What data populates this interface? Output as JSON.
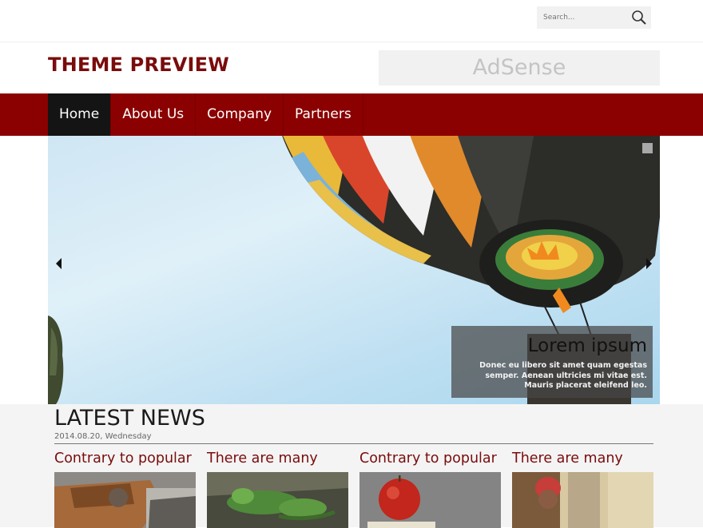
{
  "search": {
    "placeholder": "Search..."
  },
  "header": {
    "logo": "THEME PREVIEW",
    "ad_label": "AdSense"
  },
  "nav": {
    "items": [
      "Home",
      "About Us",
      "Company",
      "Partners"
    ]
  },
  "slider": {
    "caption_title": "Lorem ipsum",
    "caption_text": "Donec eu libero sit amet quam egestas semper. Aenean ultricies mi vitae est. Mauris placerat eleifend leo."
  },
  "news": {
    "heading": "LATEST NEWS",
    "date": "2014.08.20, Wednesday",
    "cards": [
      {
        "title": "Contrary to popular"
      },
      {
        "title": "There are many"
      },
      {
        "title": "Contrary to popular"
      },
      {
        "title": "There are many"
      }
    ]
  },
  "colors": {
    "brand": "#8b0000",
    "logo": "#7a0c0c",
    "active_nav": "#141414"
  }
}
